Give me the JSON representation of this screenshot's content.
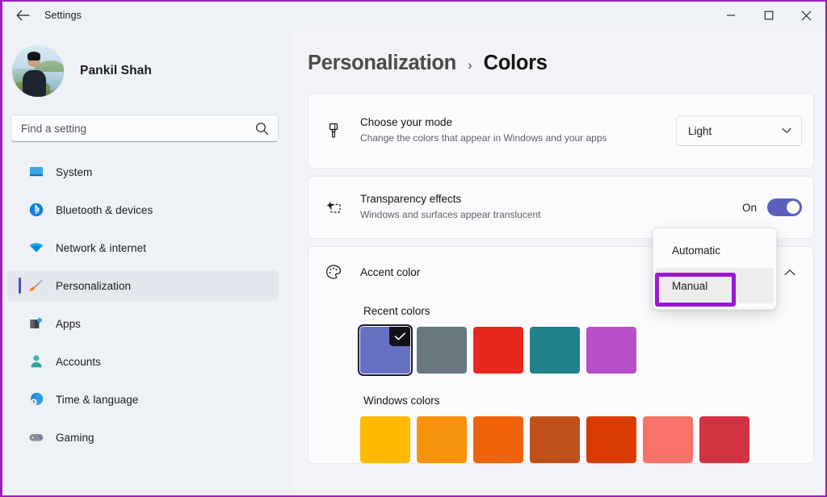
{
  "window": {
    "title": "Settings",
    "back_icon": "back-arrow-icon",
    "minimize_label": "—",
    "maximize_label": "▢",
    "close_label": "✕"
  },
  "sidebar": {
    "profile": {
      "name": "Pankil Shah",
      "avatar": "user-avatar-photo"
    },
    "search": {
      "placeholder": "Find a setting",
      "value": "",
      "icon": "search-icon"
    },
    "items": [
      {
        "label": "System",
        "icon": "system-monitor-icon",
        "selected": false
      },
      {
        "label": "Bluetooth & devices",
        "icon": "bluetooth-icon",
        "selected": false
      },
      {
        "label": "Network & internet",
        "icon": "wifi-icon",
        "selected": false
      },
      {
        "label": "Personalization",
        "icon": "paintbrush-icon",
        "selected": true
      },
      {
        "label": "Apps",
        "icon": "apps-icon",
        "selected": false
      },
      {
        "label": "Accounts",
        "icon": "account-person-icon",
        "selected": false
      },
      {
        "label": "Time & language",
        "icon": "clock-globe-icon",
        "selected": false
      },
      {
        "label": "Gaming",
        "icon": "gamepad-icon",
        "selected": false
      }
    ]
  },
  "breadcrumb": {
    "parent": "Personalization",
    "separator": "›",
    "current": "Colors"
  },
  "settings": {
    "choose_mode": {
      "title": "Choose your mode",
      "subtitle": "Change the colors that appear in Windows and your apps",
      "icon": "paintbrush-icon",
      "dropdown_value": "Light",
      "dropdown_icon": "chevron-down-icon"
    },
    "transparency": {
      "title": "Transparency effects",
      "subtitle": "Windows and surfaces appear translucent",
      "icon": "transparency-sparkle-icon",
      "toggle_state": "On"
    },
    "accent_color": {
      "title": "Accent color",
      "icon": "color-palette-icon",
      "expander_icon": "chevron-up-icon",
      "recent_colors_label": "Recent colors",
      "recent_colors": [
        {
          "hex": "#6670c0",
          "selected": true
        },
        {
          "hex": "#68787f",
          "selected": false
        },
        {
          "hex": "#e8271e",
          "selected": false
        },
        {
          "hex": "#21818c",
          "selected": false
        },
        {
          "hex": "#b64fc8",
          "selected": false
        }
      ],
      "windows_colors_label": "Windows colors",
      "windows_colors": [
        {
          "hex": "#ffb900"
        },
        {
          "hex": "#f7930a"
        },
        {
          "hex": "#f1620d"
        },
        {
          "hex": "#c0501b"
        },
        {
          "hex": "#da3b01"
        },
        {
          "hex": "#f7736a"
        },
        {
          "hex": "#d13440"
        }
      ]
    }
  },
  "dropdown_menu": {
    "options": [
      {
        "label": "Automatic",
        "hovered": false
      },
      {
        "label": "Manual",
        "hovered": true
      }
    ]
  },
  "annotation": {
    "highlight_color": "#9b18d6",
    "target": "Manual"
  },
  "accent": {
    "toggle_on": "#5b60bf",
    "selection_indicator": "#4a4fb8",
    "window_border": "#9b1fb8"
  }
}
